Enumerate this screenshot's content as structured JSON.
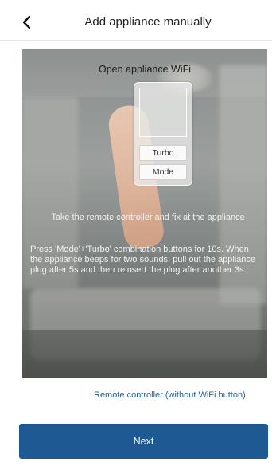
{
  "header": {
    "title": "Add appliance manually",
    "back_icon": "chevron-left-icon"
  },
  "illustration": {
    "title": "Open appliance WiFi",
    "remote": {
      "turbo_label": "Turbo",
      "mode_label": "Mode"
    },
    "instruction_main": "Take the remote controller and fix at the appliance",
    "instruction_detail": "Press 'Mode'+'Turbo' combination buttons for 10s. When the appliance beeps for two sounds, pull out the appliance plug after 5s and then reinsert the plug after another 3s."
  },
  "link_label": "Remote controller (without WiFi button)",
  "next_label": "Next",
  "colors": {
    "primary": "#1f5994",
    "link": "#1f5c9e"
  }
}
